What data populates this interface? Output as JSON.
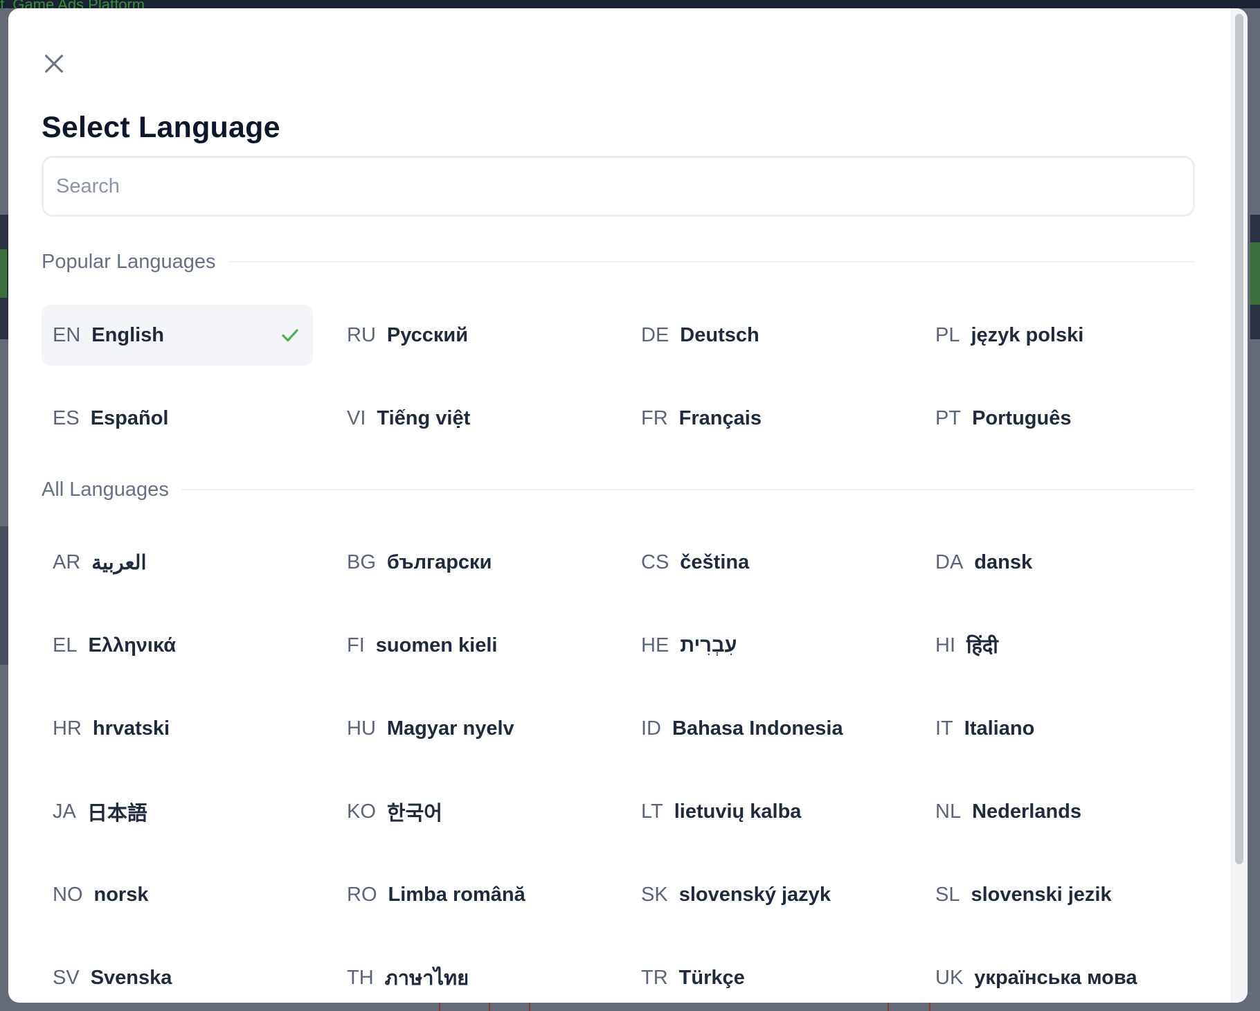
{
  "background": {
    "app_title_fragment": "f. Game Ads Platform"
  },
  "modal": {
    "title": "Select Language",
    "close_icon": "close-icon",
    "search": {
      "placeholder": "Search",
      "value": ""
    },
    "popular_section_label": "Popular Languages",
    "all_section_label": "All Languages",
    "selected_code": "EN",
    "check_color": "#4caf50",
    "popular": [
      {
        "code": "EN",
        "name": "English",
        "selected": true
      },
      {
        "code": "RU",
        "name": "Русский"
      },
      {
        "code": "DE",
        "name": "Deutsch"
      },
      {
        "code": "PL",
        "name": "język polski"
      },
      {
        "code": "ES",
        "name": "Español"
      },
      {
        "code": "VI",
        "name": "Tiếng việt"
      },
      {
        "code": "FR",
        "name": "Français"
      },
      {
        "code": "PT",
        "name": "Português"
      }
    ],
    "all": [
      {
        "code": "AR",
        "name": "العربية"
      },
      {
        "code": "BG",
        "name": "български"
      },
      {
        "code": "CS",
        "name": "čeština"
      },
      {
        "code": "DA",
        "name": "dansk"
      },
      {
        "code": "EL",
        "name": "Ελληνικά"
      },
      {
        "code": "FI",
        "name": "suomen kieli"
      },
      {
        "code": "HE",
        "name": "עִבְרִית"
      },
      {
        "code": "HI",
        "name": "हिंदी"
      },
      {
        "code": "HR",
        "name": "hrvatski"
      },
      {
        "code": "HU",
        "name": "Magyar nyelv"
      },
      {
        "code": "ID",
        "name": "Bahasa Indonesia"
      },
      {
        "code": "IT",
        "name": "Italiano"
      },
      {
        "code": "JA",
        "name": "日本語"
      },
      {
        "code": "KO",
        "name": "한국어"
      },
      {
        "code": "LT",
        "name": "lietuvių kalba"
      },
      {
        "code": "NL",
        "name": "Nederlands"
      },
      {
        "code": "NO",
        "name": "norsk"
      },
      {
        "code": "RO",
        "name": "Limba română"
      },
      {
        "code": "SK",
        "name": "slovenský jazyk"
      },
      {
        "code": "SL",
        "name": "slovenski jezik"
      },
      {
        "code": "SV",
        "name": "Svenska"
      },
      {
        "code": "TH",
        "name": "ภาษาไทย"
      },
      {
        "code": "TR",
        "name": "Türkçe"
      },
      {
        "code": "UK",
        "name": "українська мова"
      }
    ]
  }
}
